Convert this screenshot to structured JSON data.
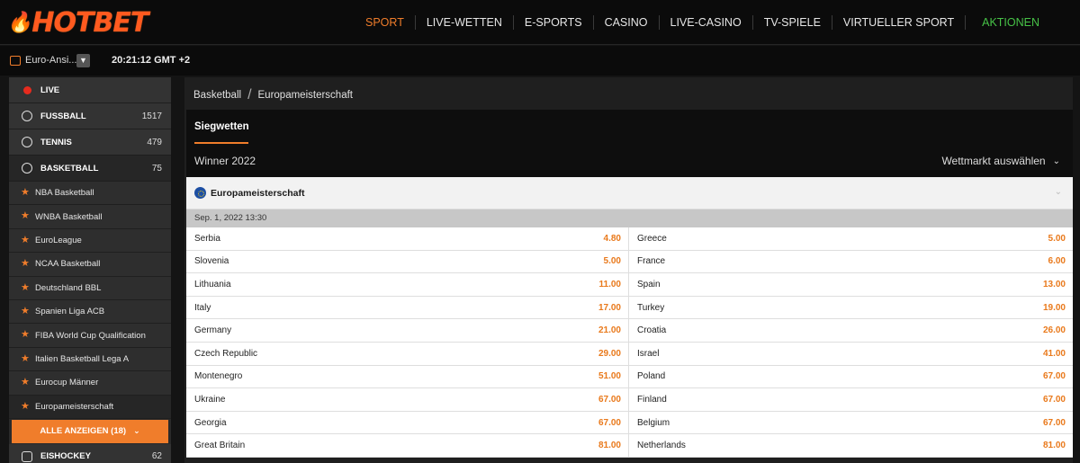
{
  "header": {
    "logo": "HOTBET",
    "nav": [
      {
        "label": "SPORT",
        "state": "active"
      },
      {
        "label": "LIVE-WETTEN"
      },
      {
        "label": "E-SPORTS"
      },
      {
        "label": "CASINO"
      },
      {
        "label": "LIVE-CASINO"
      },
      {
        "label": "TV-SPIELE"
      },
      {
        "label": "VIRTUELLER SPORT"
      },
      {
        "label": "AKTIONEN",
        "state": "promo"
      }
    ]
  },
  "subbar": {
    "odds_format": "Euro-Ansi...",
    "clock": "20:21:12 GMT +2"
  },
  "sidebar": {
    "items": [
      {
        "label": "LIVE",
        "icon": "live-dot-icon"
      },
      {
        "label": "FUSSBALL",
        "count": "1517",
        "icon": "football-icon"
      },
      {
        "label": "TENNIS",
        "count": "479",
        "icon": "tennis-icon"
      },
      {
        "label": "BASKETBALL",
        "count": "75",
        "icon": "basketball-icon"
      }
    ],
    "leagues": [
      "NBA Basketball",
      "WNBA Basketball",
      "EuroLeague",
      "NCAA Basketball",
      "Deutschland BBL",
      "Spanien Liga ACB",
      "FIBA World Cup Qualification",
      "Italien Basketball Lega A",
      "Eurocup Männer",
      "Europameisterschaft"
    ],
    "show_all": "ALLE ANZEIGEN (18)",
    "next_item": {
      "label": "EISHOCKEY",
      "count": "62"
    }
  },
  "main": {
    "breadcrumb": [
      "Basketball",
      "Europameisterschaft"
    ],
    "tab": "Siegwetten",
    "market_title": "Winner 2022",
    "market_select": "Wettmarkt auswählen",
    "group_title": "Europameisterschaft",
    "date": "Sep. 1, 2022 13:30",
    "rows": [
      [
        {
          "team": "Serbia",
          "odd": "4.80"
        },
        {
          "team": "Greece",
          "odd": "5.00"
        }
      ],
      [
        {
          "team": "Slovenia",
          "odd": "5.00"
        },
        {
          "team": "France",
          "odd": "6.00"
        }
      ],
      [
        {
          "team": "Lithuania",
          "odd": "11.00"
        },
        {
          "team": "Spain",
          "odd": "13.00"
        }
      ],
      [
        {
          "team": "Italy",
          "odd": "17.00"
        },
        {
          "team": "Turkey",
          "odd": "19.00"
        }
      ],
      [
        {
          "team": "Germany",
          "odd": "21.00"
        },
        {
          "team": "Croatia",
          "odd": "26.00"
        }
      ],
      [
        {
          "team": "Czech Republic",
          "odd": "29.00"
        },
        {
          "team": "Israel",
          "odd": "41.00"
        }
      ],
      [
        {
          "team": "Montenegro",
          "odd": "51.00"
        },
        {
          "team": "Poland",
          "odd": "67.00"
        }
      ],
      [
        {
          "team": "Ukraine",
          "odd": "67.00"
        },
        {
          "team": "Finland",
          "odd": "67.00"
        }
      ],
      [
        {
          "team": "Georgia",
          "odd": "67.00"
        },
        {
          "team": "Belgium",
          "odd": "67.00"
        }
      ],
      [
        {
          "team": "Great Britain",
          "odd": "81.00"
        },
        {
          "team": "Netherlands",
          "odd": "81.00"
        }
      ]
    ]
  },
  "colors": {
    "accent": "#f07d2b",
    "promo": "#47c247",
    "live": "#e62b1e"
  }
}
